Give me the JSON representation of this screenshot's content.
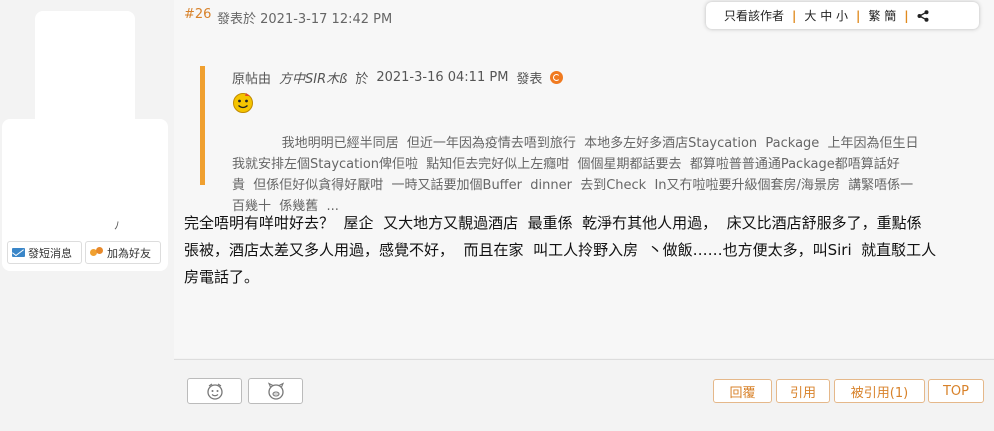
{
  "user": {
    "stub": "ﾉ",
    "pm_label": "發短消息",
    "add_friend_label": "加為好友"
  },
  "post": {
    "number": "#26",
    "meta": "發表於 2021-3-17 12:42 PM",
    "toolbar": {
      "author_only": "只看該作者",
      "font_size": "大 中 小",
      "script": "繁 簡"
    },
    "quote": {
      "prefix": "原帖由",
      "author": "方中SIR木ß",
      "at": "於",
      "datetime": "2021-3-16  04:11  PM",
      "posted": "發表",
      "text": "      我地明明已經半同居  但近一年因為疫情去唔到旅行  本地多左好多酒店Staycation  Package  上年因為佢生日\n我就安排左個Staycation俾佢啦  點知佢去完好似上左癮咁  個個星期都話要去  都算啦普普通通Package都唔算話好\n貴  但係佢好似貪得好厭咁  一時又話要加個Buffer  dinner  去到Check  In又冇啦啦要升級個套房/海景房  講緊唔係一\n百幾十  係幾舊  ..."
    },
    "content": "完全唔明有咩咁好去？  屋企  又大地方又靚過酒店  最重係  乾淨冇其他人用過，  床又比酒店舒服多了，重點係\n張被，酒店太差又多人用過，感覺不好，  而且在家  叫工人拎野入房  丶做飯……也方便太多，叫Siri  就直駁工人\n房電話了。"
  },
  "footer": {
    "reply": "回覆",
    "quote": "引用",
    "quoted": "被引用(1)",
    "top": "TOP"
  },
  "colors": {
    "accent": "#d8822a",
    "quote_bar": "#f0a030"
  }
}
